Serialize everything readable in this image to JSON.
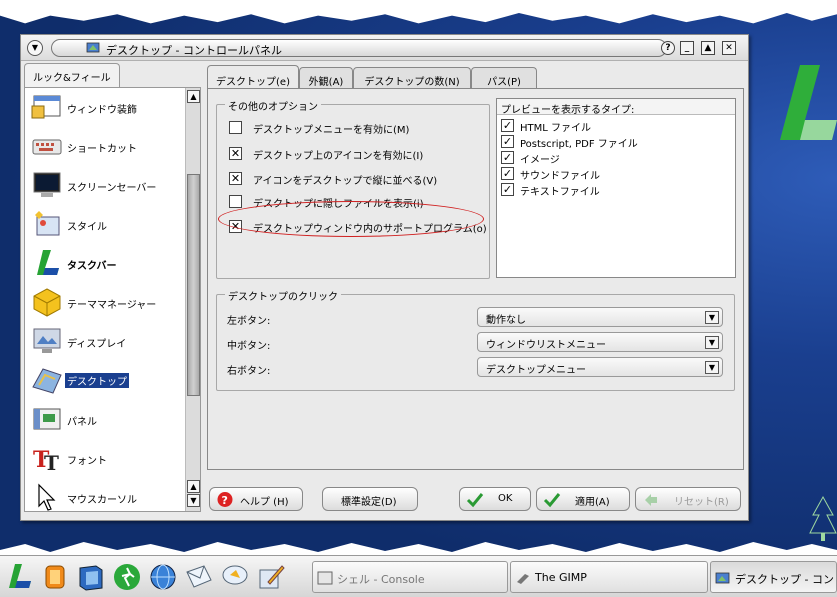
{
  "window": {
    "title": "デスクトップ - コントロールパネル",
    "buttons": {
      "help": "?",
      "minimize": "_",
      "maximize": "▲",
      "close": "✕"
    }
  },
  "sidebar": {
    "tab_label": "ルック&フィール",
    "items": [
      {
        "label": "ウィンドウ装飾",
        "icon": "window-decoration-icon"
      },
      {
        "label": "ショートカット",
        "icon": "keyboard-icon"
      },
      {
        "label": "スクリーンセーバー",
        "icon": "monitor-icon"
      },
      {
        "label": "スタイル",
        "icon": "style-icon"
      },
      {
        "label": "タスクバー",
        "icon": "taskbar-icon"
      },
      {
        "label": "テーママネージャー",
        "icon": "theme-cube-icon"
      },
      {
        "label": "ディスプレイ",
        "icon": "display-icon"
      },
      {
        "label": "デスクトップ",
        "icon": "desktop-icon",
        "selected": true
      },
      {
        "label": "パネル",
        "icon": "panel-icon"
      },
      {
        "label": "フォント",
        "icon": "font-icon"
      },
      {
        "label": "マウスカーソル",
        "icon": "mouse-cursor-icon"
      }
    ]
  },
  "tabs": [
    {
      "label": "デスクトップ(e)",
      "active": true
    },
    {
      "label": "外観(A)"
    },
    {
      "label": "デスクトップの数(N)"
    },
    {
      "label": "パス(P)"
    }
  ],
  "other_options": {
    "title": "その他のオプション",
    "items": [
      {
        "label": "デスクトップメニューを有効に(M)",
        "checked": false
      },
      {
        "label": "デスクトップ上のアイコンを有効に(I)",
        "checked": true
      },
      {
        "label": "アイコンをデスクトップで縦に並べる(V)",
        "checked": true
      },
      {
        "label": "デスクトップに隠しファイルを表示(i)",
        "checked": false
      },
      {
        "label": "デスクトップウィンドウ内のサポートプログラム(o)",
        "checked": true
      }
    ]
  },
  "preview": {
    "header": "プレビューを表示するタイプ:",
    "items": [
      {
        "label": "HTML ファイル",
        "checked": true
      },
      {
        "label": "Postscript, PDF ファイル",
        "checked": true
      },
      {
        "label": "イメージ",
        "checked": true
      },
      {
        "label": "サウンドファイル",
        "checked": true
      },
      {
        "label": "テキストファイル",
        "checked": true
      }
    ]
  },
  "desktop_click": {
    "title": "デスクトップのクリック",
    "rows": [
      {
        "label": "左ボタン:",
        "value": "動作なし"
      },
      {
        "label": "中ボタン:",
        "value": "ウィンドウリストメニュー"
      },
      {
        "label": "右ボタン:",
        "value": "デスクトップメニュー"
      }
    ]
  },
  "footer": {
    "help": "ヘルプ (H)",
    "defaults": "標準設定(D)",
    "ok": "OK",
    "apply": "適用(A)",
    "reset": "リセット(R)"
  },
  "taskbar": {
    "tasks": [
      {
        "label": "シェル - Console"
      },
      {
        "label": "The GIMP"
      },
      {
        "label": "デスクトップ - コントロ"
      }
    ]
  },
  "colors": {
    "selection": "#1a3f8f",
    "annotation": "#d02020",
    "desktop": "#0f2d6b"
  }
}
